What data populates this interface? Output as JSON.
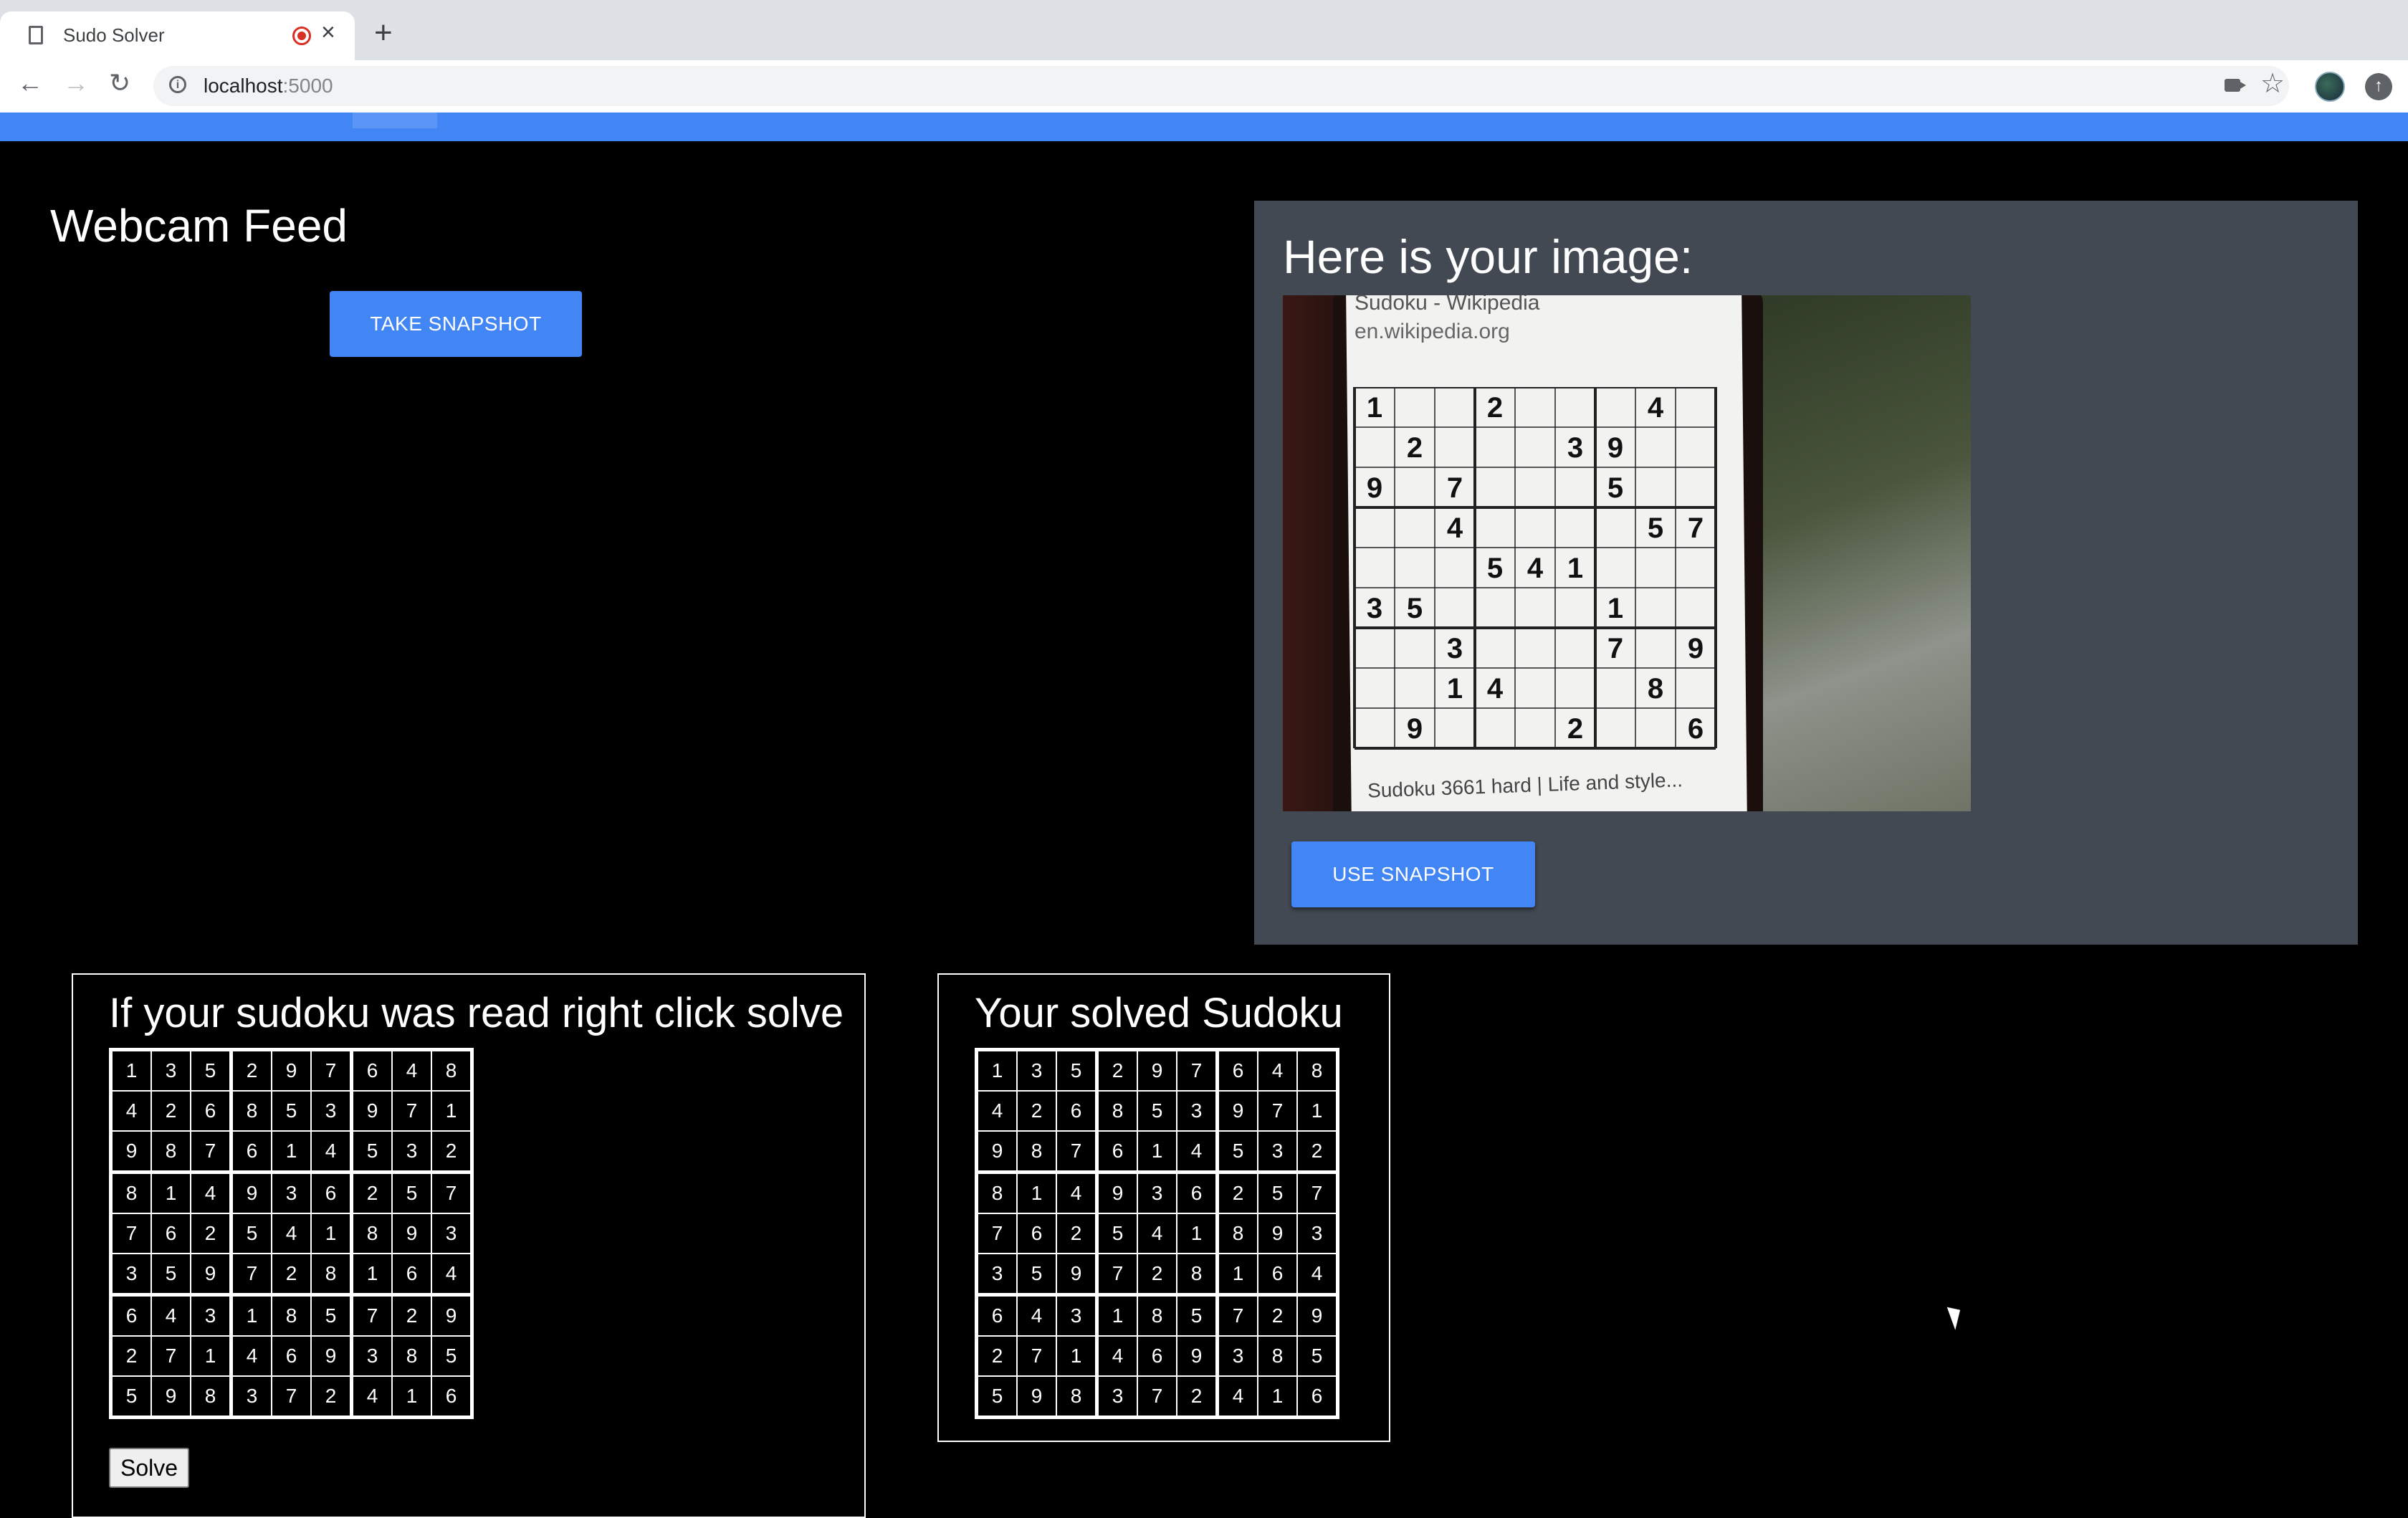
{
  "browser": {
    "tab_title": "Sudo Solver",
    "url_host": "localhost",
    "url_port": ":5000"
  },
  "webcam": {
    "title": "Webcam Feed",
    "take_snapshot_label": "TAKE SNAPSHOT"
  },
  "snapshot_panel": {
    "title": "Here is your image:",
    "photo_caption_top": "Sudoku - Wikipedia",
    "photo_caption_url": "en.wikipedia.org",
    "photo_caption_bottom": "Sudoku 3661 hard | Life and style...",
    "photo_givens": [
      [
        1,
        0,
        0,
        2,
        0,
        0,
        0,
        4,
        0
      ],
      [
        0,
        2,
        0,
        0,
        0,
        3,
        9,
        0,
        0
      ],
      [
        9,
        0,
        7,
        0,
        0,
        0,
        5,
        0,
        0
      ],
      [
        0,
        0,
        4,
        0,
        0,
        0,
        0,
        5,
        7
      ],
      [
        0,
        0,
        0,
        5,
        4,
        1,
        0,
        0,
        0
      ],
      [
        3,
        5,
        0,
        0,
        0,
        0,
        1,
        0,
        0
      ],
      [
        0,
        0,
        3,
        0,
        0,
        0,
        7,
        0,
        9
      ],
      [
        0,
        0,
        1,
        4,
        0,
        0,
        0,
        8,
        0
      ],
      [
        0,
        9,
        0,
        0,
        0,
        2,
        0,
        0,
        6
      ]
    ],
    "use_snapshot_label": "USE SNAPSHOT"
  },
  "read_sudoku": {
    "heading": "If your sudoku was read right click solve",
    "solve_label": "Solve",
    "grid": [
      [
        1,
        3,
        5,
        2,
        9,
        7,
        6,
        4,
        8
      ],
      [
        4,
        2,
        6,
        8,
        5,
        3,
        9,
        7,
        1
      ],
      [
        9,
        8,
        7,
        6,
        1,
        4,
        5,
        3,
        2
      ],
      [
        8,
        1,
        4,
        9,
        3,
        6,
        2,
        5,
        7
      ],
      [
        7,
        6,
        2,
        5,
        4,
        1,
        8,
        9,
        3
      ],
      [
        3,
        5,
        9,
        7,
        2,
        8,
        1,
        6,
        4
      ],
      [
        6,
        4,
        3,
        1,
        8,
        5,
        7,
        2,
        9
      ],
      [
        2,
        7,
        1,
        4,
        6,
        9,
        3,
        8,
        5
      ],
      [
        5,
        9,
        8,
        3,
        7,
        2,
        4,
        1,
        6
      ]
    ]
  },
  "solved_sudoku": {
    "heading": "Your solved Sudoku",
    "grid": [
      [
        1,
        3,
        5,
        2,
        9,
        7,
        6,
        4,
        8
      ],
      [
        4,
        2,
        6,
        8,
        5,
        3,
        9,
        7,
        1
      ],
      [
        9,
        8,
        7,
        6,
        1,
        4,
        5,
        3,
        2
      ],
      [
        8,
        1,
        4,
        9,
        3,
        6,
        2,
        5,
        7
      ],
      [
        7,
        6,
        2,
        5,
        4,
        1,
        8,
        9,
        3
      ],
      [
        3,
        5,
        9,
        7,
        2,
        8,
        1,
        6,
        4
      ],
      [
        6,
        4,
        3,
        1,
        8,
        5,
        7,
        2,
        9
      ],
      [
        2,
        7,
        1,
        4,
        6,
        9,
        3,
        8,
        5
      ],
      [
        5,
        9,
        8,
        3,
        7,
        2,
        4,
        1,
        6
      ]
    ]
  },
  "colors": {
    "accent": "#4285f4",
    "panel": "#424953",
    "background": "#000000"
  }
}
